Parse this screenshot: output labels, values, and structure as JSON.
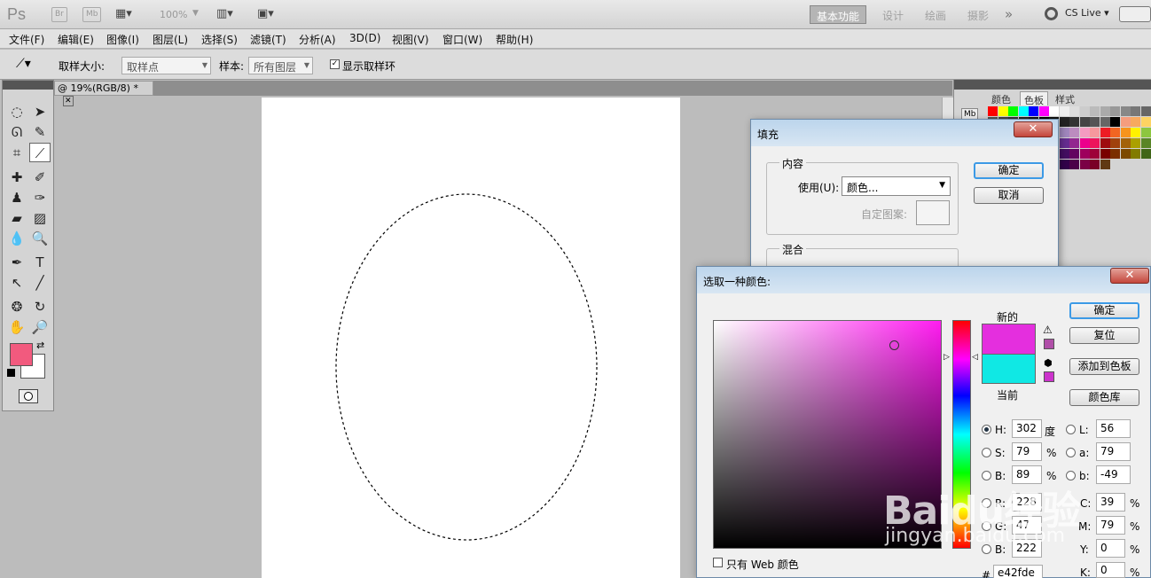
{
  "appbar": {
    "logo": "Ps",
    "bridge": "Br",
    "mini_bridge": "Mb",
    "zoom": "100%",
    "workspaces": [
      "基本功能",
      "设计",
      "绘画",
      "摄影"
    ],
    "more": "»",
    "cs_live": "CS Live"
  },
  "menu": [
    "文件(F)",
    "编辑(E)",
    "图像(I)",
    "图层(L)",
    "选择(S)",
    "滤镜(T)",
    "分析(A)",
    "3D(D)",
    "视图(V)",
    "窗口(W)",
    "帮助(H)"
  ],
  "options": {
    "sample_size_label": "取样大小:",
    "sample_size_value": "取样点",
    "sample_label": "样本:",
    "sample_value": "所有图层",
    "show_ring_label": "显示取样环"
  },
  "document": {
    "tab_title": "@ 19%(RGB/8) *",
    "close": "✕"
  },
  "right_panel": {
    "tabs": [
      "颜色",
      "色板",
      "样式"
    ],
    "active_tab": "色板",
    "mb_label": "Mb"
  },
  "fill_dialog": {
    "title": "填充",
    "close": "✕",
    "content_group": "内容",
    "use_label": "使用(U):",
    "use_value": "颜色...",
    "custom_pattern_label": "自定图案:",
    "blend_group": "混合",
    "ok": "确定",
    "cancel": "取消"
  },
  "color_picker": {
    "title": "选取一种颜色:",
    "close": "✕",
    "new_label": "新的",
    "current_label": "当前",
    "new_color": "#e42fde",
    "current_color": "#10e8e4",
    "ok": "确定",
    "reset": "复位",
    "add_swatch": "添加到色板",
    "color_library": "颜色库",
    "web_only": "只有 Web 颜色",
    "H": {
      "label": "H:",
      "value": "302",
      "unit": "度"
    },
    "S": {
      "label": "S:",
      "value": "79",
      "unit": "%"
    },
    "B": {
      "label": "B:",
      "value": "89",
      "unit": "%"
    },
    "R": {
      "label": "R:",
      "value": "228"
    },
    "G": {
      "label": "G:",
      "value": "47"
    },
    "Bl": {
      "label": "B:",
      "value": "222"
    },
    "L": {
      "label": "L:",
      "value": "56"
    },
    "a": {
      "label": "a:",
      "value": "79"
    },
    "b": {
      "label": "b:",
      "value": "-49"
    },
    "C": {
      "label": "C:",
      "value": "39",
      "unit": "%"
    },
    "M": {
      "label": "M:",
      "value": "79",
      "unit": "%"
    },
    "Y": {
      "label": "Y:",
      "value": "0",
      "unit": "%"
    },
    "K": {
      "label": "K:",
      "value": "0",
      "unit": "%"
    },
    "hex_label": "#",
    "hex": "e42fde"
  },
  "tools": {
    "foreground_color": "#f25a7e",
    "background_color": "#ffffff"
  },
  "watermark": {
    "main": "Baidu经验",
    "sub": "jingyan.baidu.com"
  }
}
